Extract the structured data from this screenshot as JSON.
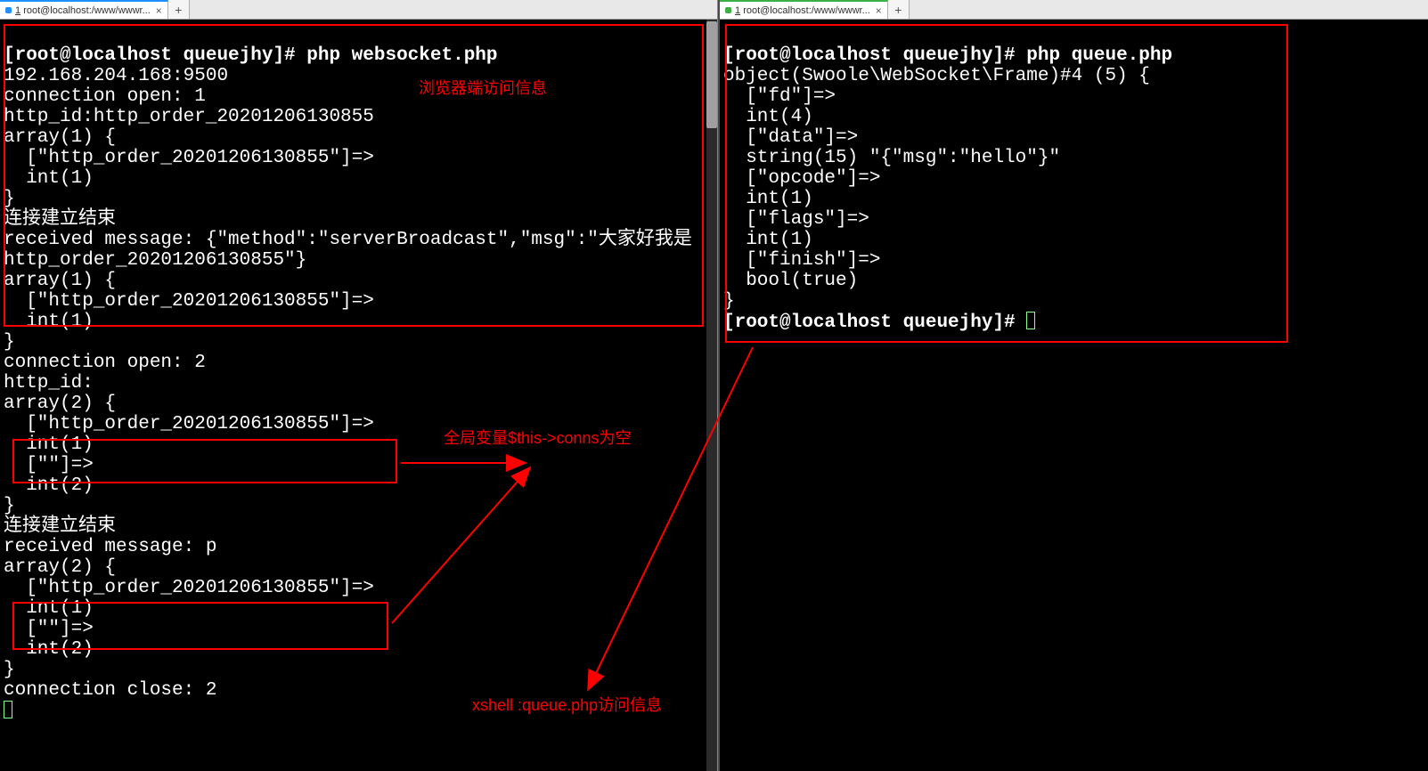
{
  "left": {
    "tab": {
      "index": "1",
      "title": "root@localhost:/www/wwwr..."
    },
    "prompt": "[root@localhost queuejhy]#",
    "cmd": "php websocket.php",
    "lines": [
      "192.168.204.168:9500",
      "connection open: 1",
      "http_id:http_order_20201206130855",
      "array(1) {",
      "  [\"http_order_20201206130855\"]=>",
      "  int(1)",
      "}",
      "连接建立结束",
      "received message: {\"method\":\"serverBroadcast\",\"msg\":\"大家好我是",
      "http_order_20201206130855\"}",
      "array(1) {",
      "  [\"http_order_20201206130855\"]=>",
      "  int(1)",
      "}",
      "connection open: 2",
      "http_id:",
      "array(2) {",
      "  [\"http_order_20201206130855\"]=>",
      "  int(1)",
      "  [\"\"]=>",
      "  int(2)",
      "}",
      "连接建立结束",
      "received message: p",
      "array(2) {",
      "  [\"http_order_20201206130855\"]=>",
      "  int(1)",
      "  [\"\"]=>",
      "  int(2)",
      "}",
      "connection close: 2"
    ]
  },
  "right": {
    "tab": {
      "index": "1",
      "title": "root@localhost:/www/wwwr..."
    },
    "prompt": "[root@localhost queuejhy]#",
    "cmd": "php queue.php",
    "lines": [
      "object(Swoole\\WebSocket\\Frame)#4 (5) {",
      "  [\"fd\"]=>",
      "  int(4)",
      "  [\"data\"]=>",
      "  string(15) \"{\"msg\":\"hello\"}\"",
      "  [\"opcode\"]=>",
      "  int(1)",
      "  [\"flags\"]=>",
      "  int(1)",
      "  [\"finish\"]=>",
      "  bool(true)",
      "}"
    ],
    "prompt2": "[root@localhost queuejhy]#"
  },
  "annotations": {
    "browser_access": "浏览器端访问信息",
    "global_var_empty": "全局变量$this->conns为空",
    "xshell_queue": "xshell :queue.php访问信息"
  }
}
